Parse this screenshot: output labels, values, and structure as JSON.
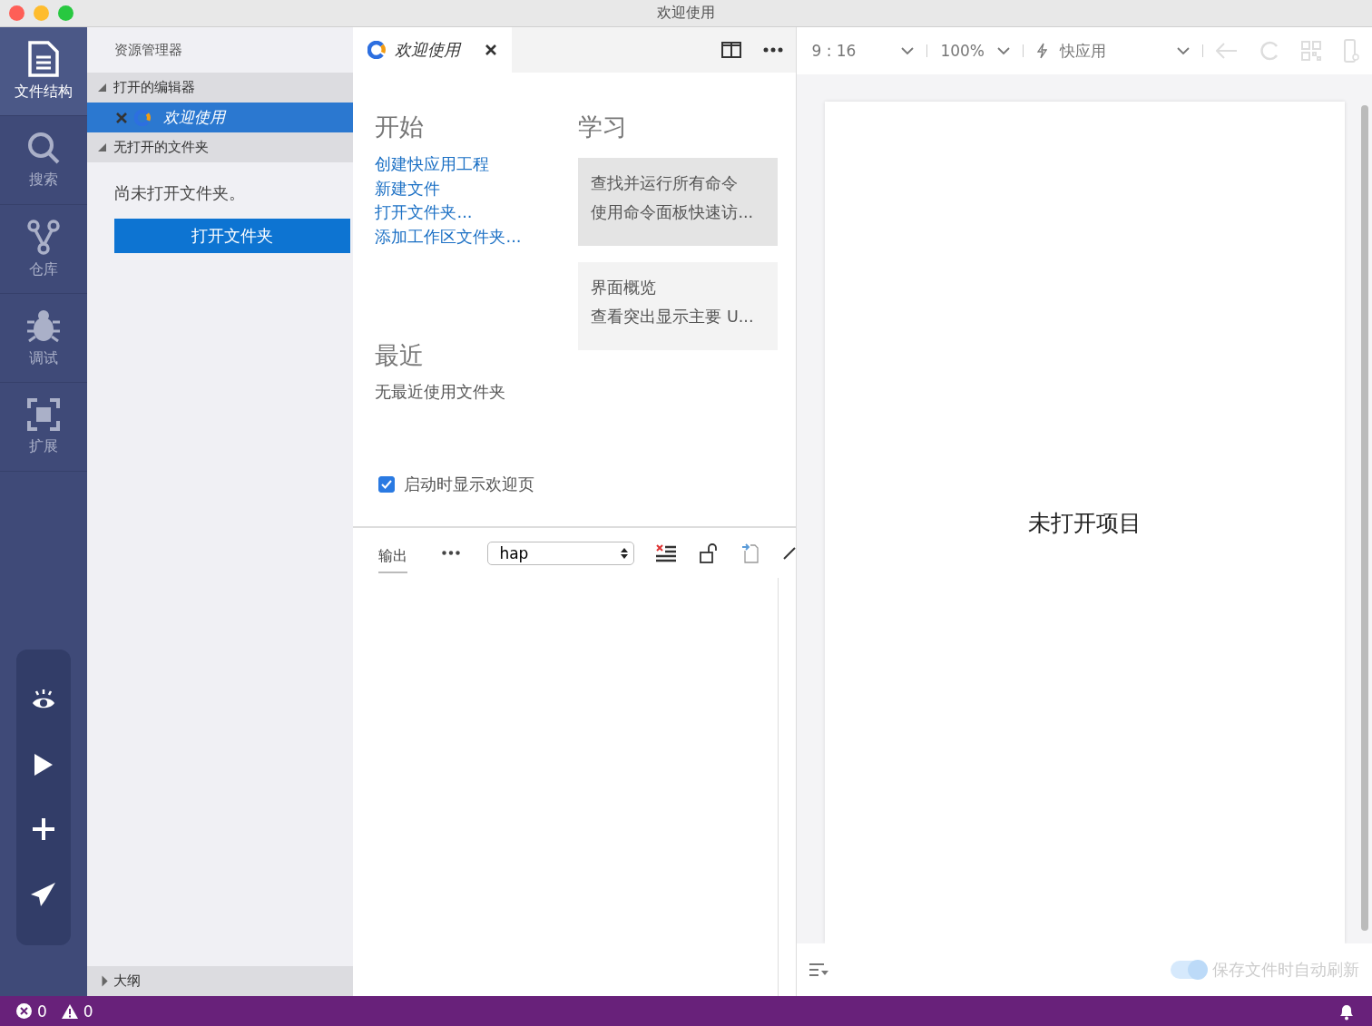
{
  "window": {
    "title": "欢迎使用"
  },
  "activity_bar": {
    "items": [
      {
        "label": "文件结构",
        "selected": true
      },
      {
        "label": "搜索",
        "selected": false
      },
      {
        "label": "仓库",
        "selected": false
      },
      {
        "label": "调试",
        "selected": false
      },
      {
        "label": "扩展",
        "selected": false
      }
    ]
  },
  "explorer": {
    "title": "资源管理器",
    "sections": [
      {
        "label": "打开的编辑器",
        "expanded": true,
        "children": [
          {
            "label": "欢迎使用",
            "selected": true
          }
        ]
      },
      {
        "label": "无打开的文件夹",
        "expanded": true
      }
    ],
    "empty_message": "尚未打开文件夹。",
    "open_folder_button": "打开文件夹",
    "outline": {
      "label": "大纲",
      "expanded": false
    }
  },
  "editor": {
    "tabs": [
      {
        "label": "欢迎使用",
        "selected": true
      }
    ],
    "start": {
      "title": "开始",
      "links": [
        "创建快应用工程",
        "新建文件",
        "打开文件夹...",
        "添加工作区文件夹..."
      ]
    },
    "recent": {
      "title": "最近",
      "empty": "无最近使用文件夹"
    },
    "learn": {
      "title": "学习",
      "cards": [
        {
          "title": "查找并运行所有命令",
          "description": "使用命令面板快速访...",
          "highlighted": true
        },
        {
          "title": "界面概览",
          "description": "查看突出显示主要 U...",
          "highlighted": false
        }
      ]
    },
    "show_on_startup": {
      "label": "启动时显示欢迎页",
      "checked": true
    }
  },
  "panel": {
    "tabs": [
      {
        "label": "输出",
        "selected": true
      }
    ],
    "channel_select": {
      "value": "hap"
    }
  },
  "preview": {
    "ratio": "9 : 16",
    "zoom": "100%",
    "platform": "快应用",
    "message": "未打开项目",
    "auto_refresh": {
      "label": "保存文件时自动刷新",
      "on": true,
      "disabled": true
    }
  },
  "status_bar": {
    "errors": "0",
    "warnings": "0"
  }
}
